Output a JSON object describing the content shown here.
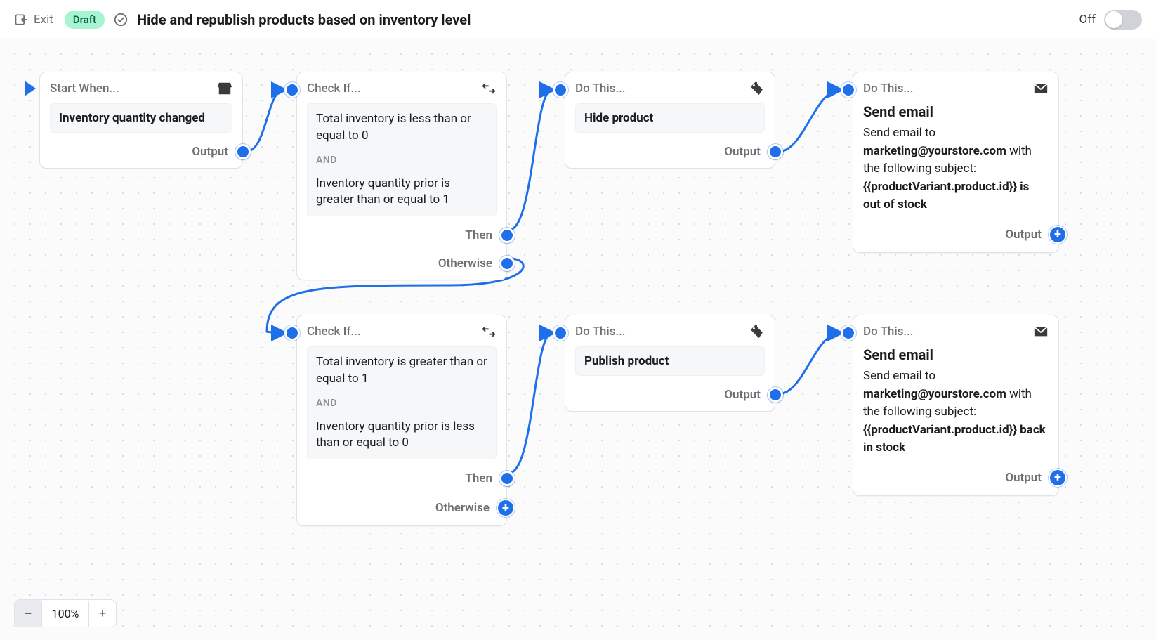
{
  "header": {
    "exit_label": "Exit",
    "badge": "Draft",
    "title": "Hide and republish products based on inventory level",
    "toggle_state_label": "Off"
  },
  "zoom": {
    "value": "100%"
  },
  "labels": {
    "output": "Output",
    "then": "Then",
    "otherwise": "Otherwise",
    "and": "AND"
  },
  "nodes": {
    "trigger": {
      "type": "trigger",
      "head": "Start When...",
      "title": "Inventory quantity changed"
    },
    "cond1": {
      "type": "condition",
      "head": "Check If...",
      "rule1": "Total inventory is less than or equal to 0",
      "rule2": "Inventory quantity prior is greater than or equal to 1"
    },
    "cond2": {
      "type": "condition",
      "head": "Check If...",
      "rule1": "Total inventory is greater than or equal to 1",
      "rule2": "Inventory quantity prior is less than or equal to 0"
    },
    "hide": {
      "type": "action",
      "head": "Do This...",
      "title": "Hide product"
    },
    "publish": {
      "type": "action",
      "head": "Do This...",
      "title": "Publish product"
    },
    "email1": {
      "type": "action",
      "head": "Do This...",
      "title": "Send email",
      "line_prefix": "Send email to ",
      "email": "marketing@yourstore.com",
      "line_mid": " with the following subject: ",
      "template": "{{productVariant.product.id}} is out of stock"
    },
    "email2": {
      "type": "action",
      "head": "Do This...",
      "title": "Send email",
      "line_prefix": "Send email to ",
      "email": "marketing@yourstore.com",
      "line_mid": " with the following subject: ",
      "template": "{{productVariant.product.id}} back in stock"
    }
  }
}
